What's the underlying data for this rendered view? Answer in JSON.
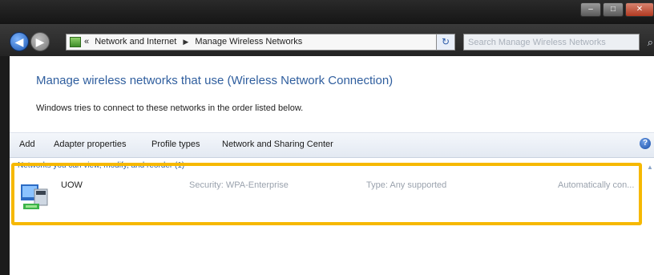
{
  "window": {
    "minimize_glyph": "–",
    "maximize_glyph": "□",
    "close_glyph": "✕"
  },
  "addressbar": {
    "back_glyph": "◀",
    "forward_glyph": "▶",
    "overflow_glyph": "«",
    "breadcrumbs": [
      "Network and Internet",
      "Manage Wireless Networks"
    ],
    "separator_glyph": "▶",
    "dropdown_glyph": "▾",
    "refresh_glyph": "↻",
    "search_placeholder": "Search Manage Wireless Networks",
    "search_glyph": "⌕"
  },
  "page": {
    "title": "Manage wireless networks that use (Wireless Network Connection)",
    "description": "Windows tries to connect to these networks in the order listed below."
  },
  "toolbar": {
    "items": [
      "Add",
      "Adapter properties",
      "Profile types",
      "Network and Sharing Center"
    ],
    "help_glyph": "?"
  },
  "networks": {
    "group_label": "Networks you can view, modify, and reorder (1)",
    "collapse_glyph": "▲",
    "items": [
      {
        "name": "UOW",
        "security": "Security: WPA-Enterprise",
        "type": "Type: Any supported",
        "mode": "Automatically con..."
      }
    ]
  },
  "colors": {
    "highlight": "#f6b800",
    "title_blue": "#2f5e9e"
  }
}
